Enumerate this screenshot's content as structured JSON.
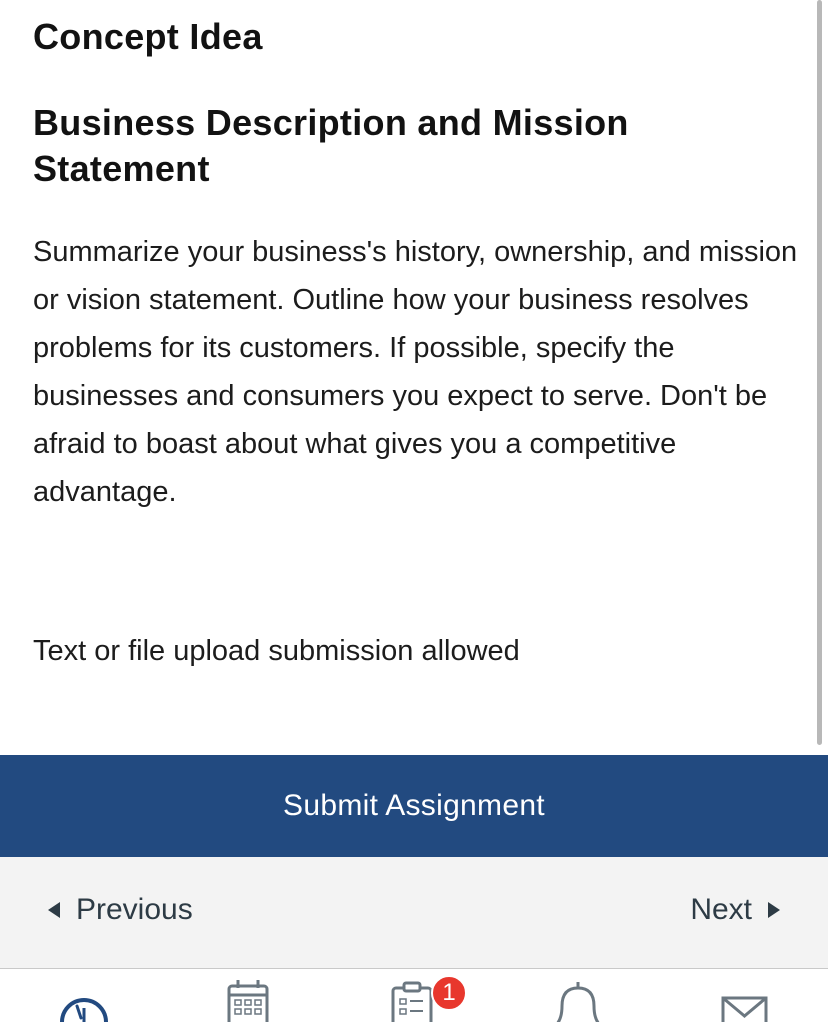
{
  "page": {
    "title": "Concept Idea",
    "heading": "Business Description and Mission Statement",
    "description": "Summarize your business's history, ownership, and mission or vision statement. Outline how your business resolves problems for its customers. If possible, specify the businesses and consumers you expect to serve. Don't be afraid to boast about what gives you a competitive advantage.",
    "submission_type": "Text or file upload submission allowed"
  },
  "actions": {
    "submit_label": "Submit Assignment"
  },
  "pager": {
    "previous_label": "Previous",
    "next_label": "Next"
  },
  "tabbar": {
    "tabs": [
      {
        "icon": "dashboard-icon"
      },
      {
        "icon": "calendar-icon"
      },
      {
        "icon": "todo-icon",
        "badge": "1"
      },
      {
        "icon": "notifications-icon"
      },
      {
        "icon": "inbox-icon"
      }
    ]
  },
  "colors": {
    "accent": "#224a80",
    "badge": "#e8372d",
    "tab_icon": "#6b7780",
    "dashboard_icon": "#224a80"
  }
}
